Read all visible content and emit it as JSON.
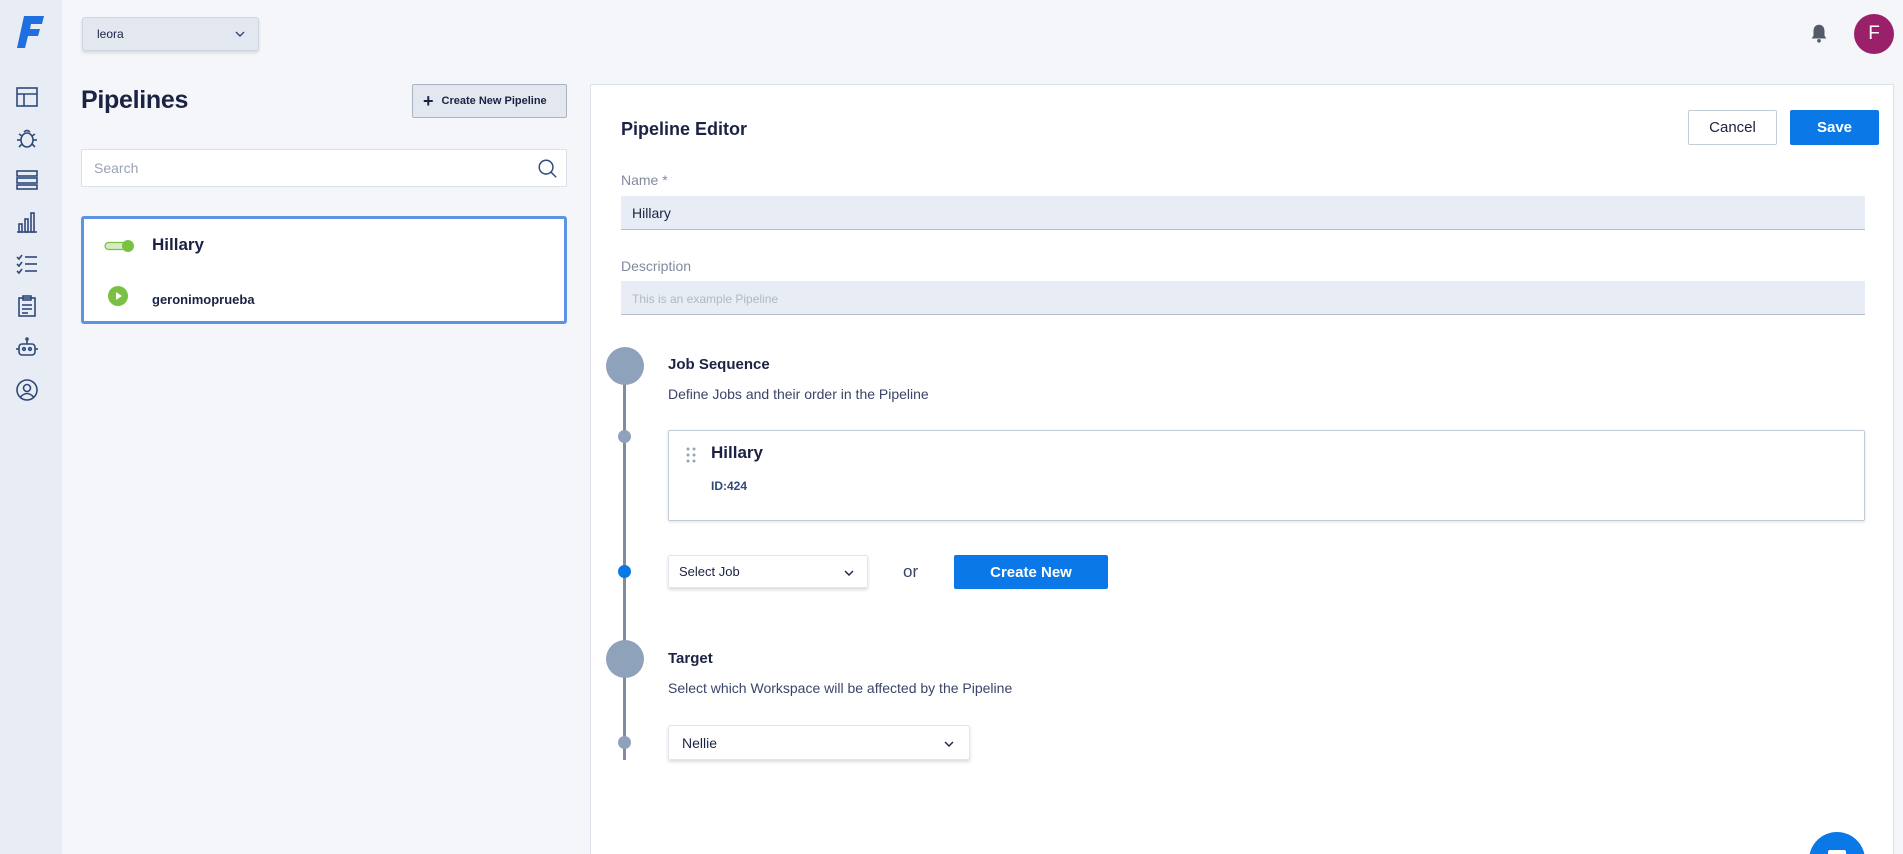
{
  "workspace_selector": {
    "value": "leora"
  },
  "user": {
    "avatar_letter": "F",
    "avatar_color": "#9a2069"
  },
  "sidebar": {
    "logo": "F",
    "items": [
      {
        "icon": "dashboard-icon"
      },
      {
        "icon": "bug-icon"
      },
      {
        "icon": "servers-icon"
      },
      {
        "icon": "analytics-icon"
      },
      {
        "icon": "tasklist-icon"
      },
      {
        "icon": "clipboard-icon"
      },
      {
        "icon": "robot-icon"
      },
      {
        "icon": "user-circle-icon"
      }
    ]
  },
  "pipelines_panel": {
    "title": "Pipelines",
    "create_button": "Create New Pipeline",
    "search_placeholder": "Search",
    "items": [
      {
        "name": "Hillary",
        "workspace": "geronimoprueba",
        "enabled": true
      }
    ]
  },
  "editor": {
    "title": "Pipeline Editor",
    "cancel_label": "Cancel",
    "save_label": "Save",
    "name_label": "Name *",
    "name_value": "Hillary",
    "description_label": "Description",
    "description_placeholder": "This is an example Pipeline",
    "job_sequence": {
      "title": "Job Sequence",
      "description": "Define Jobs and their order in the Pipeline",
      "jobs": [
        {
          "name": "Hillary",
          "id_label": "ID:424"
        }
      ],
      "select_job_label": "Select Job",
      "or_label": "or",
      "create_new_label": "Create New"
    },
    "target": {
      "title": "Target",
      "description": "Select which Workspace will be affected by the Pipeline",
      "selected_workspace": "Nellie"
    }
  },
  "colors": {
    "accent": "#0b78e8",
    "selection_border": "#5c93e6",
    "toggle_on": "#7ac143",
    "timeline": "#8fa2bb"
  }
}
